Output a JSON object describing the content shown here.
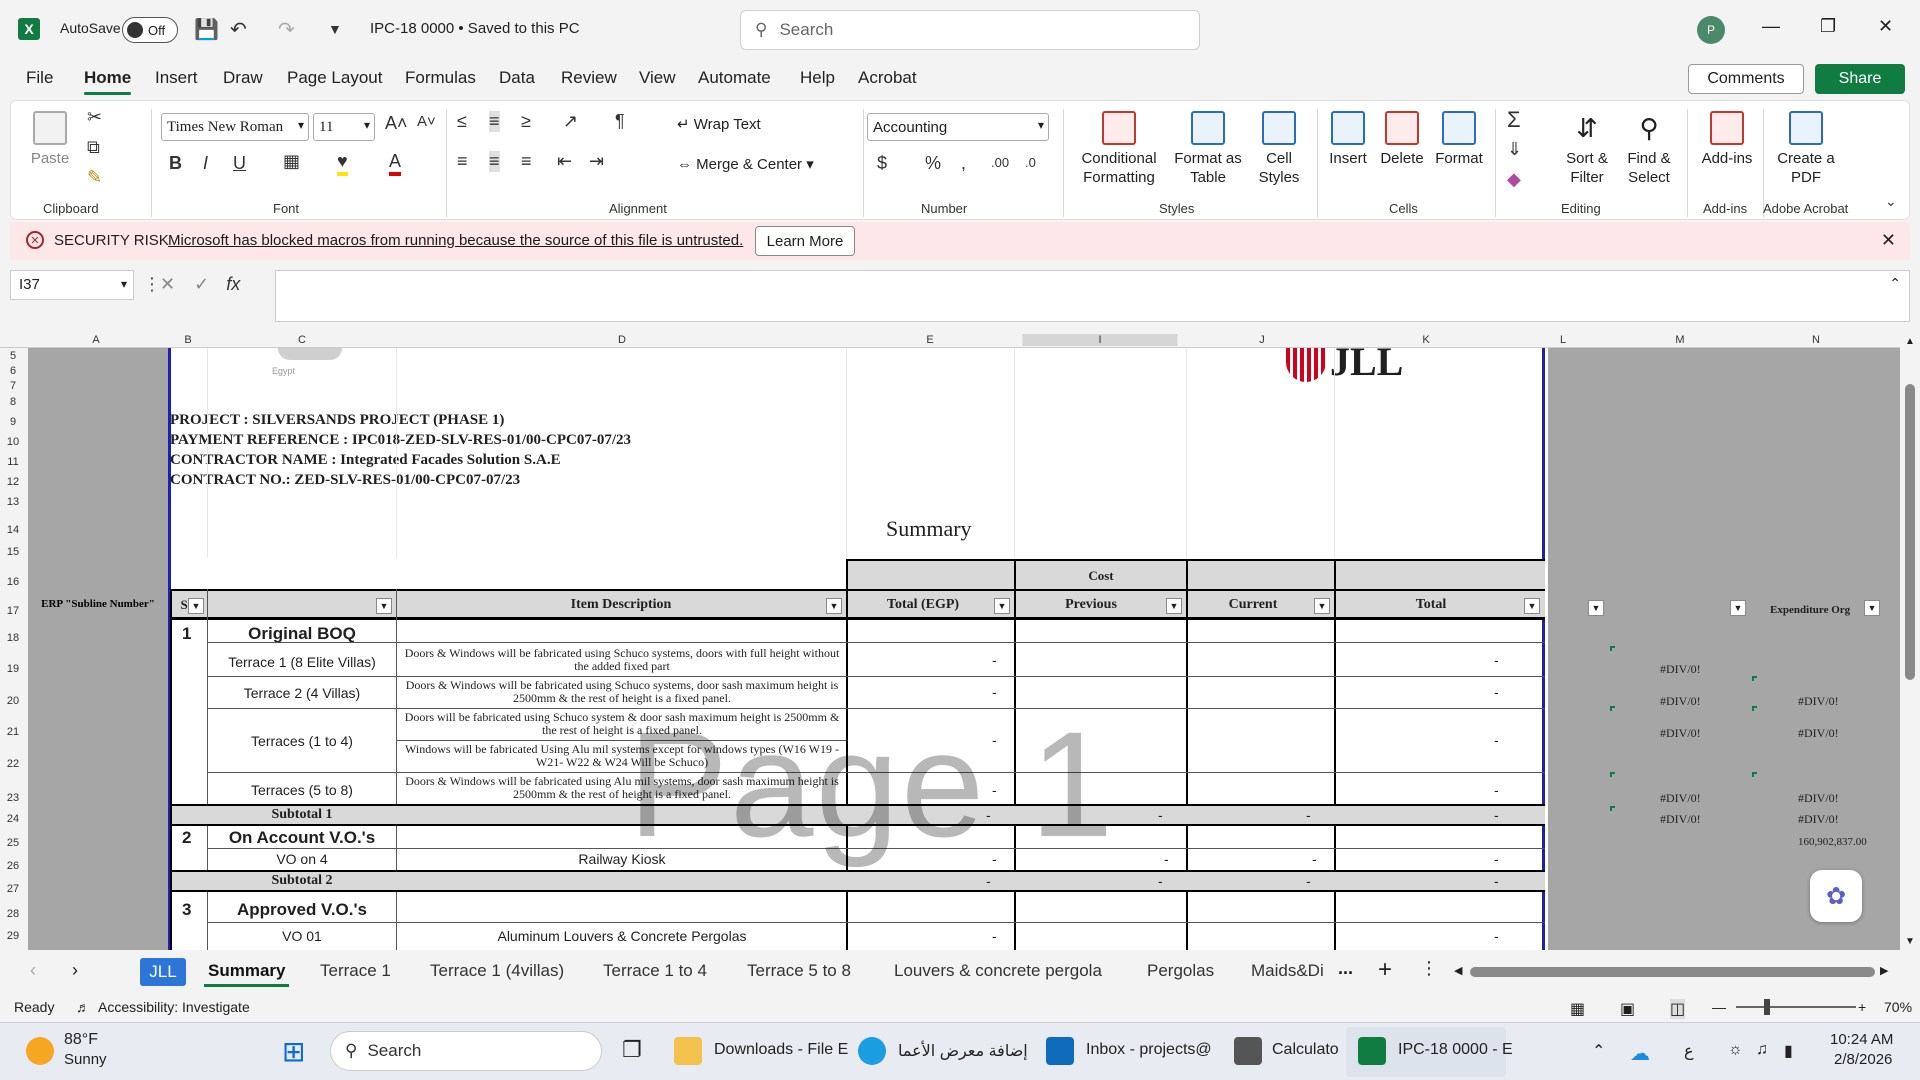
{
  "titlebar": {
    "autosave_label": "AutoSave",
    "autosave_state": "Off",
    "doc_title": "IPC-18 0000 • Saved to this PC",
    "search_placeholder": "Search",
    "avatar_initial": "P"
  },
  "menu": {
    "items": [
      "File",
      "Home",
      "Insert",
      "Draw",
      "Page Layout",
      "Formulas",
      "Data",
      "Review",
      "View",
      "Automate",
      "Help",
      "Acrobat"
    ],
    "active": "Home",
    "comments": "Comments",
    "share": "Share"
  },
  "ribbon": {
    "clipboard": {
      "paste": "Paste",
      "label": "Clipboard"
    },
    "font": {
      "name": "Times New Roman",
      "size": "11",
      "label": "Font"
    },
    "alignment": {
      "wrap": "Wrap Text",
      "merge": "Merge & Center",
      "label": "Alignment"
    },
    "number": {
      "format": "Accounting",
      "label": "Number"
    },
    "styles": {
      "conditional": "Conditional Formatting",
      "format_table": "Format as Table",
      "cell_styles": "Cell Styles",
      "label": "Styles"
    },
    "cells": {
      "insert": "Insert",
      "delete": "Delete",
      "format": "Format",
      "label": "Cells"
    },
    "editing": {
      "sort": "Sort & Filter",
      "find": "Find & Select",
      "label": "Editing"
    },
    "addins": {
      "btn": "Add-ins",
      "label": "Add-ins"
    },
    "acrobat": {
      "btn": "Create a PDF",
      "label": "Adobe Acrobat"
    }
  },
  "security": {
    "title": "SECURITY RISK",
    "message": "Microsoft has blocked macros from running because the source of this file is untrusted.",
    "learn_more": "Learn More"
  },
  "formula_bar": {
    "name_box": "I37",
    "formula": ""
  },
  "columns": [
    "A",
    "B",
    "C",
    "D",
    "E",
    "I",
    "J",
    "K",
    "L",
    "M",
    "N"
  ],
  "rows": [
    "5",
    "6",
    "7",
    "8",
    "9",
    "10",
    "11",
    "12",
    "13",
    "14",
    "15",
    "16",
    "17",
    "18",
    "19",
    "20",
    "21",
    "22",
    "23",
    "24",
    "25",
    "26",
    "27",
    "28",
    "29"
  ],
  "sheet": {
    "logo_text": "JLL",
    "company_sub": "Egypt",
    "project": "PROJECT : SILVERSANDS PROJECT (PHASE 1)",
    "payment_ref": "PAYMENT REFERENCE : IPC018-ZED-SLV-RES-01/00-CPC07-07/23",
    "contractor": "CONTRACTOR NAME : Integrated Facades Solution S.A.E",
    "contract_no": "CONTRACT NO.: ZED-SLV-RES-01/00-CPC07-07/23",
    "summary_title": "Summary",
    "cost_header": "Cost",
    "erp_header": "ERP \"Subline Number\"",
    "sr_header": "Sr",
    "item_desc_header": "Item Description",
    "total_egp_header": "Total (EGP)",
    "previous_header": "Previous",
    "current_header": "Current",
    "total_header": "Total",
    "expenditure_header": "Expenditure Org",
    "sections": [
      {
        "num": "1",
        "name": "Original BOQ"
      },
      {
        "num": "2",
        "name": "On Account V.O.'s"
      },
      {
        "num": "3",
        "name": "Approved V.O.'s"
      }
    ],
    "items": [
      {
        "name": "Terrace 1 (8 Elite Villas)",
        "desc": "Doors & Windows will be fabricated using Schuco systems, doors with full height without the added fixed part"
      },
      {
        "name": "Terrace 2 (4 Villas)",
        "desc": "Doors & Windows will be fabricated using Schuco systems, door sash maximum height is 2500mm & the rest of height is a fixed panel."
      },
      {
        "name": "Terraces (1 to 4)",
        "desc": "Doors will be fabricated using Schuco system & door sash maximum height is 2500mm & the rest of height is a fixed panel.",
        "desc2": "Windows will be fabricated Using Alu mil systems except for windows types (W16 W19 - W21- W22 & W24 Will be Schuco)"
      },
      {
        "name": "Terraces (5 to 8)",
        "desc": "Doors & Windows will be fabricated using Alu mil systems, door sash maximum height is 2500mm & the rest of height is a fixed panel."
      }
    ],
    "subtotal1": "Subtotal 1",
    "vo_on4": {
      "name": "VO on 4",
      "desc": "Railway Kiosk"
    },
    "subtotal2": "Subtotal 2",
    "vo01": {
      "name": "VO 01",
      "desc": "Aluminum Louvers & Concrete Pergolas"
    },
    "dash": "-",
    "div0": "#DIV/0!",
    "big_value": "160,902,837.00",
    "watermark": "Page 1"
  },
  "tabs": {
    "items": [
      "JLL",
      "Summary",
      "Terrace 1",
      "Terrace 1 (4villas)",
      "Terrace 1 to 4",
      "Terrace 5 to 8",
      "Louvers & concrete pergola",
      "Pergolas",
      "Maids&Di"
    ],
    "active": "Summary",
    "more": "..."
  },
  "status": {
    "ready": "Ready",
    "accessibility": "Accessibility: Investigate",
    "zoom": "70%"
  },
  "taskbar": {
    "temp": "88°F",
    "weather": "Sunny",
    "search": "Search",
    "apps": [
      "Downloads - File E",
      "إضافة معرض الأعما",
      "Inbox - projects@",
      "Calculato",
      "IPC-18 0000 - E"
    ],
    "lang": "ع",
    "time": "10:24 AM",
    "date": "2/8/2026"
  }
}
